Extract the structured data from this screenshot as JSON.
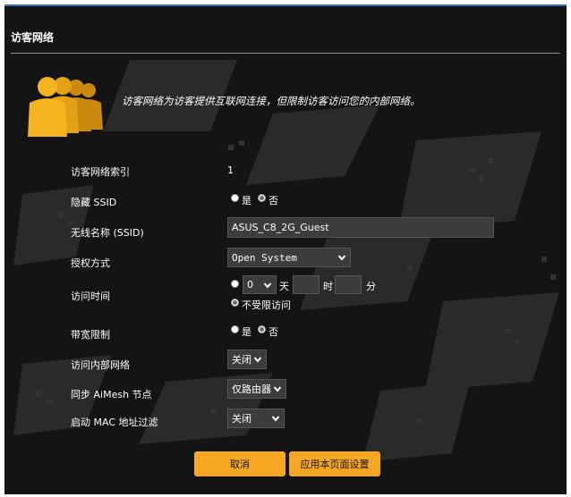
{
  "page": {
    "title": "访客网络"
  },
  "header": {
    "description": "访客网络为访客提供互联网连接，但限制访客访问您的内部网络。"
  },
  "form": {
    "index": {
      "label": "访客网络索引",
      "value": "1"
    },
    "hide_ssid": {
      "label": "隐藏 SSID",
      "options": [
        {
          "label": "是",
          "checked": false
        },
        {
          "label": "否",
          "checked": true
        }
      ]
    },
    "ssid": {
      "label": "无线名称 (SSID)",
      "value": "ASUS_C8_2G_Guest"
    },
    "auth": {
      "label": "授权方式",
      "value": "Open System"
    },
    "access_time": {
      "label": "访问时间",
      "day_select": "0",
      "day_unit": "天",
      "hour_value": "",
      "hour_unit": "时",
      "minute_value": "",
      "minute_unit": "分",
      "unlimited_label": "不受限访问",
      "limited_checked": false,
      "unlimited_checked": true
    },
    "bandwidth": {
      "label": "带宽限制",
      "options": [
        {
          "label": "是",
          "checked": false
        },
        {
          "label": "否",
          "checked": true
        }
      ]
    },
    "intranet": {
      "label": "访问内部网络",
      "value": "关闭"
    },
    "aimesh": {
      "label": "同步 AiMesh 节点",
      "value": "仅路由器"
    },
    "mac_filter": {
      "label": "启动 MAC 地址过滤",
      "value": "关闭"
    }
  },
  "actions": {
    "cancel": "取消",
    "apply": "应用本页面设置"
  },
  "colors": {
    "accent": "#f5a623",
    "background": "#141414",
    "title_bar_border": "#2a6bc4"
  },
  "icons": {
    "guest_icon": "guest-users-icon",
    "dropdown": "chevron-down-icon"
  }
}
